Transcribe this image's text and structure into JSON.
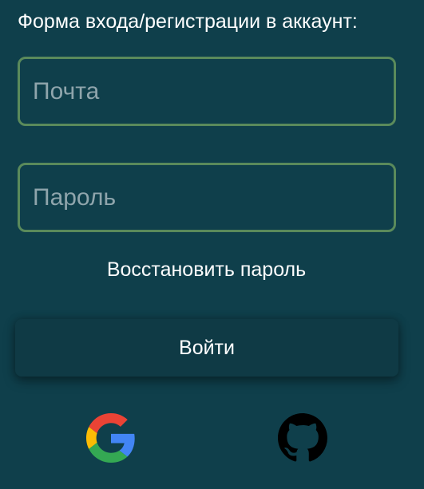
{
  "form": {
    "title": "Форма входа/регистрации в аккаунт:",
    "email_placeholder": "Почта",
    "password_placeholder": "Пароль",
    "restore_link": "Восстановить пароль",
    "login_button": "Войти"
  },
  "social": {
    "google_icon": "google-icon",
    "github_icon": "github-icon"
  },
  "colors": {
    "background": "#0f3f4b",
    "field_border": "#5a8a5b",
    "placeholder": "#8fa5ac",
    "text": "#ffffff"
  }
}
